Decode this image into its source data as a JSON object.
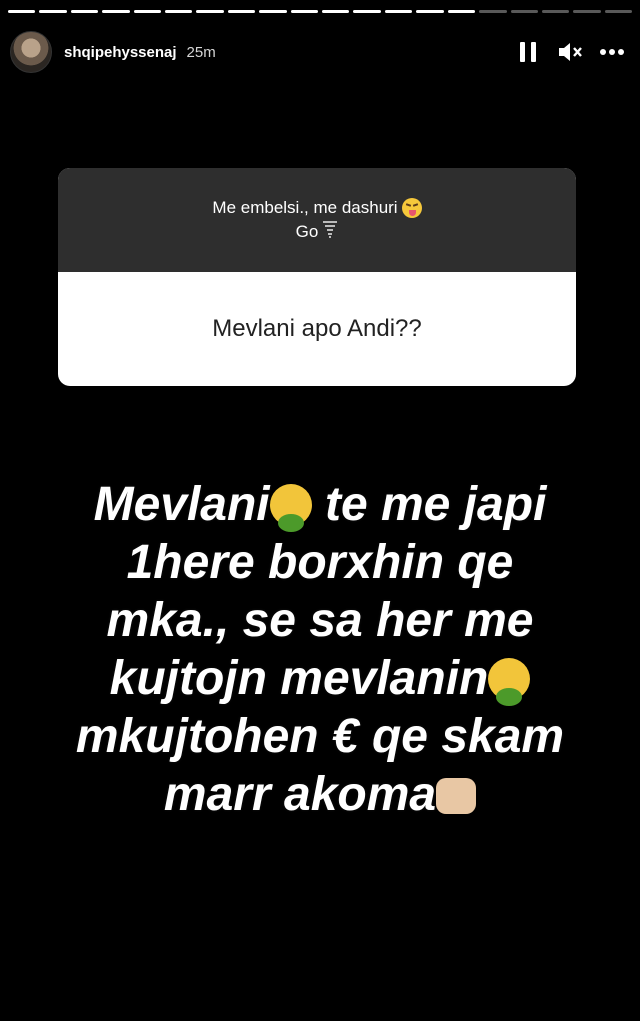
{
  "story": {
    "progress_segments": [
      1,
      1,
      1,
      1,
      1,
      1,
      1,
      1,
      1,
      1,
      1,
      1,
      1,
      1,
      1,
      0,
      0,
      0,
      0,
      0
    ],
    "username": "shqipehyssenaj",
    "time_ago": "25m"
  },
  "question_box": {
    "top_line1": "Me embelsi., me dashuri",
    "top_line2": "Go",
    "question": "Mevlani apo Andi??"
  },
  "answer": {
    "line1": "Mevlani",
    "line1b": "te me japi",
    "line2": "1here borxhin qe",
    "line3": "mka., se sa her me",
    "line4": "kujtojn mevlanin",
    "line5": "mkujtohen € qe skam",
    "line6": "marr akoma"
  },
  "icons": {
    "pause": "pause-icon",
    "mute": "mute-icon",
    "more": "more-icon"
  }
}
